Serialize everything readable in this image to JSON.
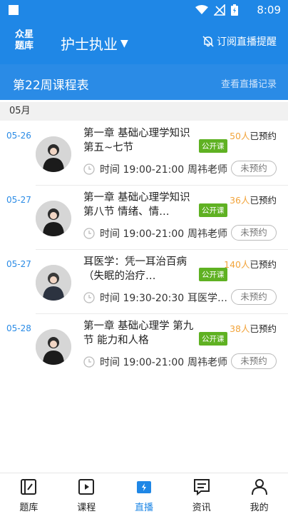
{
  "status_bar": {
    "time": "8:09"
  },
  "app_bar": {
    "logo_line1": "众星",
    "logo_line2": "题库",
    "title": "护士执业",
    "caret": "▼",
    "subscribe_label": "订阅直播提醒"
  },
  "week_bar": {
    "title": "第22周课程表",
    "link": "查看直播记录"
  },
  "month": "05月",
  "courses": [
    {
      "date": "05-26",
      "title": "第一章 基础心理学知识 第五~七节",
      "badge": "公开课",
      "count_num": "50人",
      "count_suffix": "已预约",
      "time": "时间 19:00-21:00",
      "teacher": "周祎老师",
      "status": "未预约"
    },
    {
      "date": "05-27",
      "title": "第一章 基础心理学知识 第八节 情绪、情…",
      "badge": "公开课",
      "count_num": "36人",
      "count_suffix": "已预约",
      "time": "时间 19:00-21:00",
      "teacher": "周祎老师",
      "status": "未预约"
    },
    {
      "date": "05-27",
      "title": "耳医学：凭一耳治百病（失眠的治疗…",
      "badge": "公开课",
      "count_num": "140人",
      "count_suffix": "已预约",
      "time": "时间 19:30-20:30",
      "teacher": "耳医学…",
      "status": "未预约"
    },
    {
      "date": "05-28",
      "title": "第一章 基础心理学 第九节 能力和人格",
      "badge": "公开课",
      "count_num": "38人",
      "count_suffix": "已预约",
      "time": "时间 19:00-21:00",
      "teacher": "周祎老师",
      "status": "未预约"
    }
  ],
  "tabs": [
    {
      "label": "题库",
      "icon": "question-bank-icon"
    },
    {
      "label": "课程",
      "icon": "video-course-icon"
    },
    {
      "label": "直播",
      "icon": "live-icon"
    },
    {
      "label": "资讯",
      "icon": "news-icon"
    },
    {
      "label": "我的",
      "icon": "profile-icon"
    }
  ],
  "colors": {
    "primary": "#1f87e6",
    "badge": "#5fb122",
    "count": "#f2a43b"
  }
}
